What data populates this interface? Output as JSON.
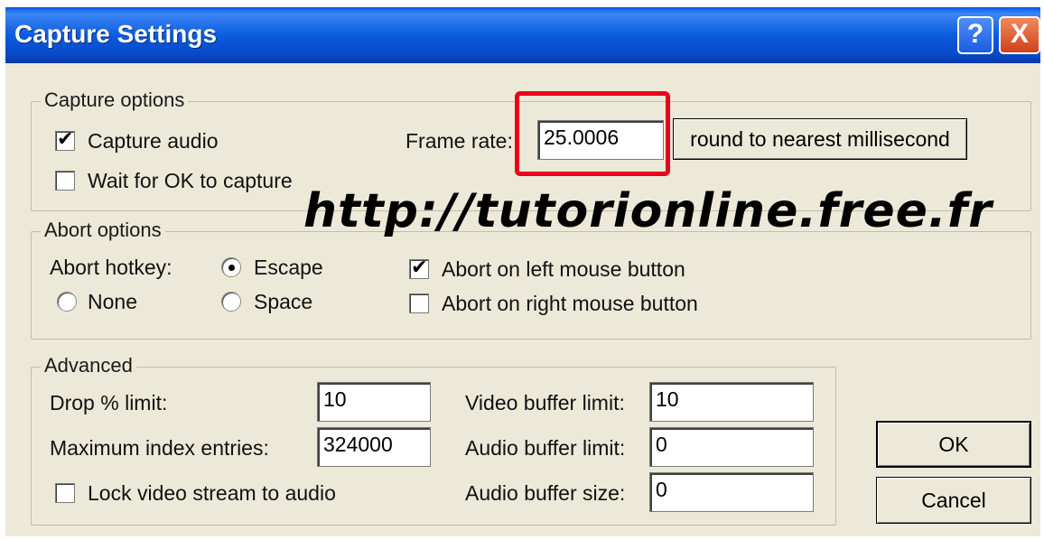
{
  "window": {
    "title": "Capture Settings",
    "help_icon": "?",
    "close_icon": "X"
  },
  "capture_options": {
    "title": "Capture options",
    "capture_audio": {
      "label": "Capture audio",
      "checked": true
    },
    "wait_for_ok": {
      "label": "Wait for OK to capture",
      "checked": false
    },
    "frame_rate_label": "Frame rate:",
    "frame_rate_value": "25.0006",
    "round_button": "round to nearest millisecond"
  },
  "watermark": "http://tutorionline.free.fr",
  "abort_options": {
    "title": "Abort options",
    "hotkey_label": "Abort hotkey:",
    "escape": {
      "label": "Escape",
      "selected": true
    },
    "none": {
      "label": "None",
      "selected": false
    },
    "space": {
      "label": "Space",
      "selected": false
    },
    "left_mouse": {
      "label": "Abort on left mouse button",
      "checked": true
    },
    "right_mouse": {
      "label": "Abort on right mouse button",
      "checked": false
    }
  },
  "advanced": {
    "title": "Advanced",
    "drop_limit_label": "Drop % limit:",
    "drop_limit_value": "10",
    "max_index_label": "Maximum index entries:",
    "max_index_value": "324000",
    "lock_video": {
      "label": "Lock video stream to audio",
      "checked": false
    },
    "video_buffer_label": "Video buffer limit:",
    "video_buffer_value": "10",
    "audio_buffer_limit_label": "Audio buffer limit:",
    "audio_buffer_limit_value": "0",
    "audio_buffer_size_label": "Audio buffer size:",
    "audio_buffer_size_value": "0"
  },
  "buttons": {
    "ok": "OK",
    "cancel": "Cancel"
  }
}
